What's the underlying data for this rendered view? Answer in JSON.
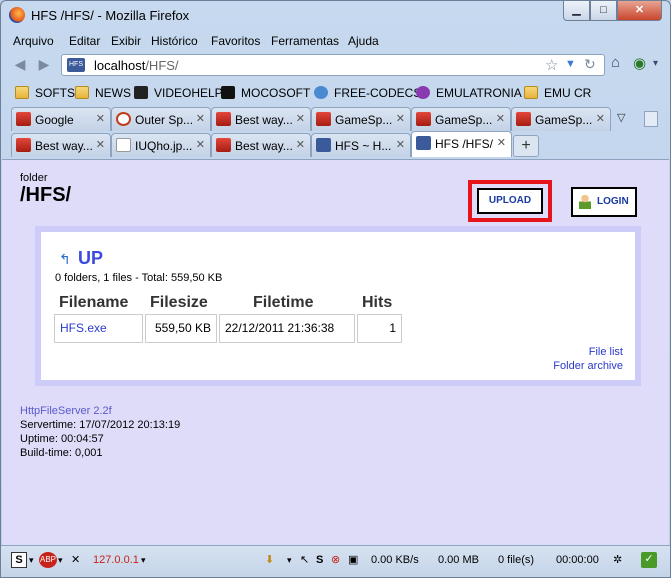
{
  "window": {
    "title": "HFS /HFS/ - Mozilla Firefox"
  },
  "menu": [
    "Arquivo",
    "Editar",
    "Exibir",
    "Histórico",
    "Favoritos",
    "Ferramentas",
    "Ajuda"
  ],
  "urlbar": {
    "host": "localhost",
    "path": "/HFS/"
  },
  "bookmarks": [
    "SOFTS",
    "NEWS",
    "VIDEOHELP",
    "MOCOSOFT",
    "FREE-CODECS",
    "EMULATRONIA",
    "EMU CR"
  ],
  "tabs": {
    "row1": [
      "Google",
      "Outer Sp...",
      "Best way...",
      "GameSp...",
      "GameSp...",
      "GameSp..."
    ],
    "row2": [
      "Best way...",
      "IUQho.jp...",
      "Best way...",
      "HFS ~ H...",
      "HFS /HFS/"
    ],
    "new_tab": "+"
  },
  "page": {
    "folder_label": "folder",
    "title": "/HFS/",
    "upload": "UPLOAD",
    "login": "LOGIN",
    "up": "UP",
    "stats": "0 folders, 1 files - Total: 559,50 KB",
    "columns": [
      "Filename",
      "Filesize",
      "Filetime",
      "Hits"
    ],
    "rows": [
      {
        "name": "HFS.exe",
        "size": "559,50 KB",
        "time": "22/12/2011 21:36:38",
        "hits": "1"
      }
    ],
    "file_list": "File list",
    "folder_archive": "Folder archive"
  },
  "footer": {
    "version": "HttpFileServer 2.2f",
    "servertime": "Servertime: 17/07/2012 20:13:19",
    "uptime": "Uptime: 00:04:57",
    "buildtime": "Build-time: 0,001"
  },
  "statusbar": {
    "ip": "127.0.0.1",
    "speed": "0.00 KB/s",
    "size": "0.00 MB",
    "files": "0 file(s)",
    "time": "00:00:00"
  }
}
